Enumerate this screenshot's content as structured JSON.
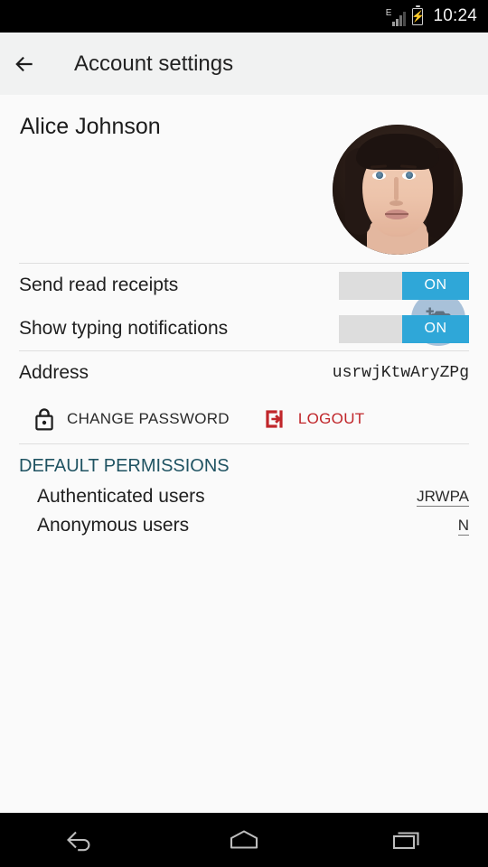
{
  "status_bar": {
    "network_type": "E",
    "clock": "10:24",
    "battery_state": "charging",
    "signal_bars": 4
  },
  "toolbar": {
    "title": "Account settings",
    "back_icon": "arrow-left-icon"
  },
  "profile": {
    "name": "Alice Johnson",
    "avatar_alt": "profile-photo",
    "camera_icon": "add-photo-camera-icon"
  },
  "settings": {
    "rows": [
      {
        "label": "Send read receipts",
        "state": "ON"
      },
      {
        "label": "Show typing notifications",
        "state": "ON"
      }
    ]
  },
  "address": {
    "label": "Address",
    "value": "usrwjKtwAryZPg"
  },
  "actions": {
    "change_password": {
      "label": "CHANGE PASSWORD",
      "icon": "lock-icon"
    },
    "logout": {
      "label": "LOGOUT",
      "icon": "logout-exit-icon",
      "color": "#c0262a"
    }
  },
  "permissions": {
    "header": "DEFAULT PERMISSIONS",
    "header_color": "#1f5362",
    "rows": [
      {
        "label": "Authenticated users",
        "value": "JRWPA"
      },
      {
        "label": "Anonymous users",
        "value": "N"
      }
    ]
  },
  "nav_bar": {
    "back_icon": "nav-back-icon",
    "home_icon": "nav-home-icon",
    "recents_icon": "nav-recents-icon"
  },
  "colors": {
    "accent": "#2fa7d8",
    "toolbar_bg": "#f1f2f2",
    "content_bg": "#fafafa",
    "fab_bg": "#a8c1d9"
  }
}
